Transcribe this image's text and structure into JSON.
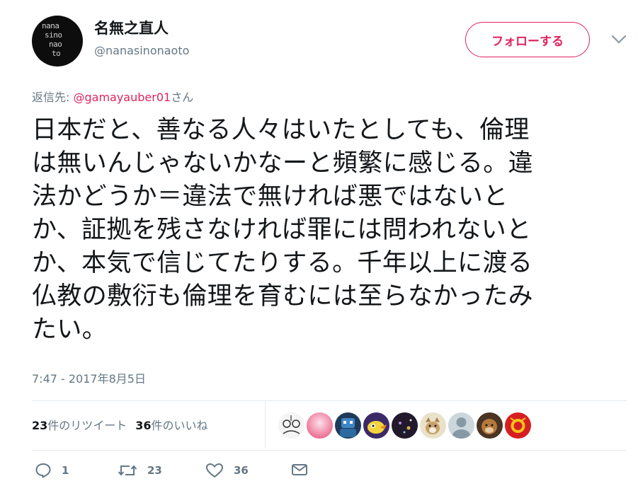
{
  "user": {
    "display_name": "名無之直人",
    "handle": "@nanasinonaoto",
    "avatar_text": [
      "nana",
      "sino",
      "nao",
      "to"
    ]
  },
  "follow_label": "フォローする",
  "reply": {
    "prefix": "返信先: ",
    "mention": "@gamayauber01",
    "suffix": "さん"
  },
  "tweet_lines": [
    "日本だと、善なる人々はいたとしても、倫理",
    "は無いんじゃないかなーと頻繁に感じる。違",
    "法かどうか＝違法で無ければ悪ではないと",
    "か、証拠を残さなければ罪には問われないと",
    "か、本気で信じてたりする。千年以上に渡る",
    "仏教の敷衍も倫理を育むには至らなかったみ",
    "たい。"
  ],
  "timestamp": "7:47 - 2017年8月5日",
  "stats": {
    "retweets_num": "23",
    "retweets_label": "件のリツイート",
    "likes_num": "36",
    "likes_label": "件のいいね"
  },
  "liker_avatars": [
    "sketch",
    "pink",
    "robot",
    "bird",
    "dark",
    "dog",
    "default",
    "animal",
    "red"
  ],
  "actions": {
    "reply_count": "1",
    "retweet_count": "23",
    "like_count": "36"
  },
  "colors": {
    "accent": "#e0245e",
    "secondary_text": "#657786",
    "divider": "#e6ecf0"
  }
}
